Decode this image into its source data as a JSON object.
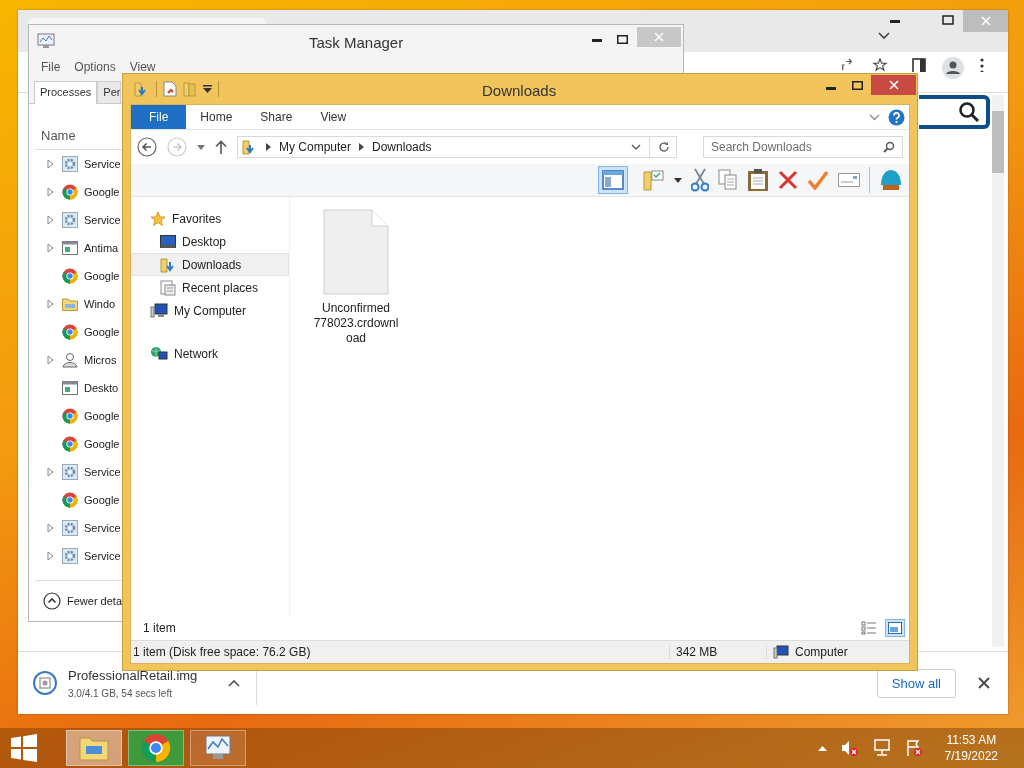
{
  "chrome": {
    "download": {
      "filename": "ProfessionalRetail.img",
      "progress": "3.0/4.1 GB, 54 secs left"
    },
    "show_all": "Show all"
  },
  "task_manager": {
    "title": "Task Manager",
    "menu": [
      "File",
      "Options",
      "View"
    ],
    "tabs": [
      {
        "label": "Processes",
        "selected": true
      },
      {
        "label": "Per",
        "selected": false
      }
    ],
    "column": "Name",
    "rows": [
      {
        "name": "Service",
        "kind": "gear",
        "expandable": true
      },
      {
        "name": "Google",
        "kind": "chrome",
        "expandable": true
      },
      {
        "name": "Service",
        "kind": "gear",
        "expandable": true
      },
      {
        "name": "Antima",
        "kind": "app",
        "expandable": true
      },
      {
        "name": "Google",
        "kind": "chrome",
        "expandable": false
      },
      {
        "name": "Windo",
        "kind": "folder",
        "expandable": true
      },
      {
        "name": "Google",
        "kind": "chrome",
        "expandable": false
      },
      {
        "name": "Micros",
        "kind": "user",
        "expandable": true
      },
      {
        "name": "Deskto",
        "kind": "app",
        "expandable": false
      },
      {
        "name": "Google",
        "kind": "chrome",
        "expandable": false
      },
      {
        "name": "Google",
        "kind": "chrome",
        "expandable": false
      },
      {
        "name": "Service",
        "kind": "gear",
        "expandable": true
      },
      {
        "name": "Google",
        "kind": "chrome",
        "expandable": false
      },
      {
        "name": "Service",
        "kind": "gear",
        "expandable": true
      },
      {
        "name": "Service",
        "kind": "gear",
        "expandable": true
      }
    ],
    "footer": "Fewer deta"
  },
  "explorer": {
    "title": "Downloads",
    "ribbon_tabs": [
      {
        "label": "File",
        "selected": true
      },
      {
        "label": "Home",
        "selected": false
      },
      {
        "label": "Share",
        "selected": false
      },
      {
        "label": "View",
        "selected": false
      }
    ],
    "path": [
      "My Computer",
      "Downloads"
    ],
    "search": {
      "placeholder": "Search Downloads"
    },
    "nav": [
      {
        "label": "Favorites",
        "kind": "star",
        "selected": false,
        "children": [
          {
            "label": "Desktop",
            "kind": "desktop",
            "selected": false
          },
          {
            "label": "Downloads",
            "kind": "downloads",
            "selected": true
          },
          {
            "label": "Recent places",
            "kind": "recent",
            "selected": false
          }
        ]
      },
      {
        "label": "My Computer",
        "kind": "computer",
        "selected": false
      },
      {
        "label": "Network",
        "kind": "network",
        "selected": false
      }
    ],
    "files": [
      {
        "name": "Unconfirmed 778023.crdownload"
      }
    ],
    "item_count": "1 item",
    "status": {
      "summary": "1 item (Disk free space: 76.2 GB)",
      "size": "342 MB",
      "location": "Computer"
    }
  },
  "taskbar": {
    "apps": [
      {
        "kind": "explorer",
        "selected": true
      },
      {
        "kind": "chrome",
        "selected": false
      },
      {
        "kind": "taskmgr",
        "selected": false
      }
    ],
    "time": "11:53 AM",
    "date": "7/19/2022"
  }
}
